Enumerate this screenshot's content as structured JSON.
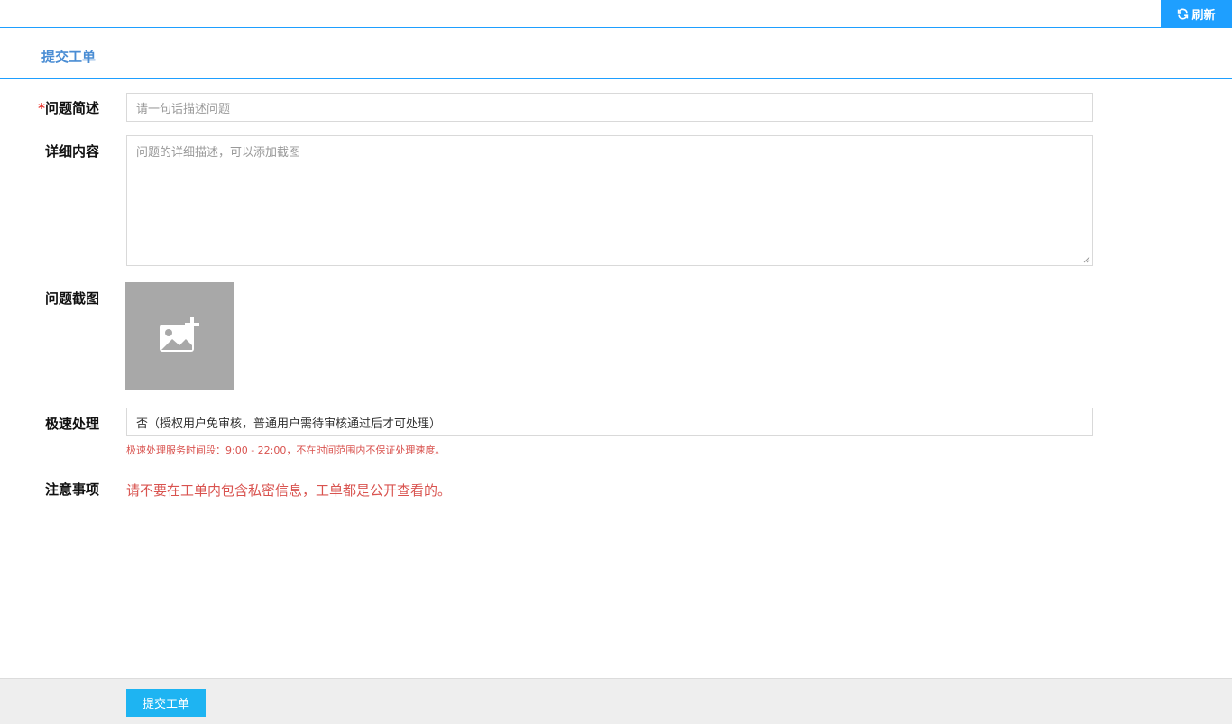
{
  "header": {
    "refresh_label": "刷新",
    "refresh_icon": "refresh-icon",
    "accent_color": "#1e9fff"
  },
  "section": {
    "title": "提交工单"
  },
  "form": {
    "summary": {
      "required_mark": "*",
      "label": "问题简述",
      "placeholder": "请一句话描述问题",
      "value": ""
    },
    "details": {
      "label": "详细内容",
      "placeholder": "问题的详细描述，可以添加截图",
      "value": ""
    },
    "screenshot": {
      "label": "问题截图",
      "icon": "add-image-icon"
    },
    "express": {
      "label": "极速处理",
      "value": "否（授权用户免审核，普通用户需待审核通过后才可处理）",
      "hint": "极速处理服务时间段：9:00 - 22:00，不在时间范围内不保证处理速度。"
    },
    "notice": {
      "label": "注意事项",
      "text": "请不要在工单内包含私密信息，工单都是公开查看的。",
      "color": "#d9534f"
    }
  },
  "footer": {
    "submit_label": "提交工单",
    "submit_color": "#1eb4f2"
  }
}
